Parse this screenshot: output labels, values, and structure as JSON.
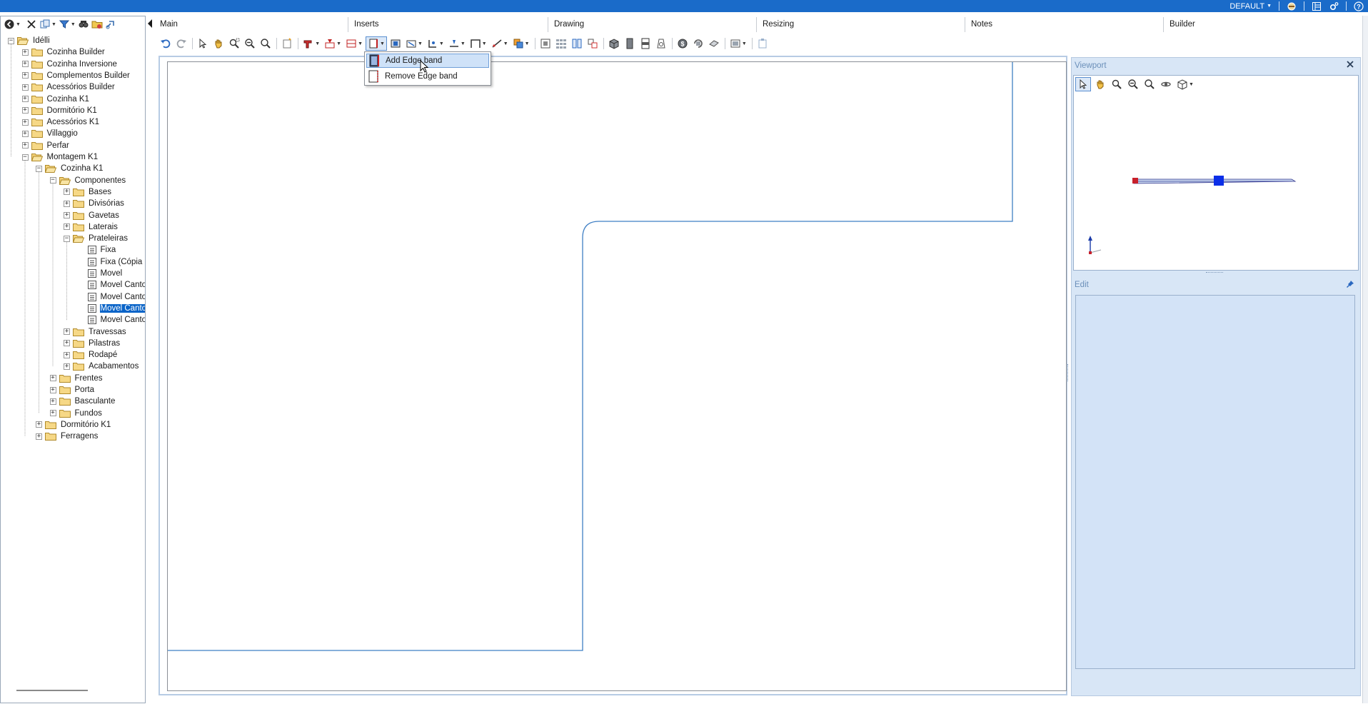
{
  "colors": {
    "title_bar": "#1a6bc9",
    "selection": "#0a64c8",
    "drawing_line": "#3f7fc4",
    "panel_bg": "#d8e6f6",
    "viewport_handle": "#0a2ee8",
    "viewport_marker": "#c8202a"
  },
  "topbar": {
    "profile": "DEFAULT",
    "icons": [
      "logo-icon",
      "layout-icon",
      "settings-icon",
      "help-icon"
    ]
  },
  "left_toolbar": {
    "icons": [
      "back-icon",
      "delete-icon",
      "copy-icon",
      "filter-icon",
      "search-icon",
      "folder-tools-icon",
      "link-icon"
    ]
  },
  "tree": {
    "items": [
      {
        "label": "Idélli",
        "level": 0,
        "type": "folder",
        "expanded": true
      },
      {
        "label": "Cozinha Builder",
        "level": 1,
        "type": "folder",
        "expanded": false
      },
      {
        "label": "Cozinha Inversione",
        "level": 1,
        "type": "folder",
        "expanded": false
      },
      {
        "label": "Complementos Builder",
        "level": 1,
        "type": "folder",
        "expanded": false
      },
      {
        "label": "Acessórios Builder",
        "level": 1,
        "type": "folder",
        "expanded": false
      },
      {
        "label": "Cozinha K1",
        "level": 1,
        "type": "folder",
        "expanded": false
      },
      {
        "label": "Dormitório K1",
        "level": 1,
        "type": "folder",
        "expanded": false
      },
      {
        "label": "Acessórios K1",
        "level": 1,
        "type": "folder",
        "expanded": false
      },
      {
        "label": "Villaggio",
        "level": 1,
        "type": "folder",
        "expanded": false
      },
      {
        "label": "Perfar",
        "level": 1,
        "type": "folder",
        "expanded": false
      },
      {
        "label": "Montagem K1",
        "level": 1,
        "type": "folder",
        "expanded": true
      },
      {
        "label": "Cozinha K1",
        "level": 2,
        "type": "folder",
        "expanded": true
      },
      {
        "label": "Componentes",
        "level": 3,
        "type": "folder",
        "expanded": true
      },
      {
        "label": "Bases",
        "level": 4,
        "type": "folder",
        "expanded": false
      },
      {
        "label": "Divisórias",
        "level": 4,
        "type": "folder",
        "expanded": false
      },
      {
        "label": "Gavetas",
        "level": 4,
        "type": "folder",
        "expanded": false
      },
      {
        "label": "Laterais",
        "level": 4,
        "type": "folder",
        "expanded": false
      },
      {
        "label": "Prateleiras",
        "level": 4,
        "type": "folder",
        "expanded": true
      },
      {
        "label": "Fixa",
        "level": 5,
        "type": "item"
      },
      {
        "label": "Fixa (Cópia",
        "level": 5,
        "type": "item"
      },
      {
        "label": "Movel",
        "level": 5,
        "type": "item"
      },
      {
        "label": "Movel Canto",
        "level": 5,
        "type": "item"
      },
      {
        "label": "Movel Canto",
        "level": 5,
        "type": "item"
      },
      {
        "label": "Movel Canto",
        "level": 5,
        "type": "item",
        "selected": true
      },
      {
        "label": "Movel Canto",
        "level": 5,
        "type": "item"
      },
      {
        "label": "Travessas",
        "level": 4,
        "type": "folder",
        "expanded": false
      },
      {
        "label": "Pilastras",
        "level": 4,
        "type": "folder",
        "expanded": false
      },
      {
        "label": "Rodapé",
        "level": 4,
        "type": "folder",
        "expanded": false
      },
      {
        "label": "Acabamentos",
        "level": 4,
        "type": "folder",
        "expanded": false
      },
      {
        "label": "Frentes",
        "level": 3,
        "type": "folder",
        "expanded": false
      },
      {
        "label": "Porta",
        "level": 3,
        "type": "folder",
        "expanded": false
      },
      {
        "label": "Basculante",
        "level": 3,
        "type": "folder",
        "expanded": false
      },
      {
        "label": "Fundos",
        "level": 3,
        "type": "folder",
        "expanded": false
      },
      {
        "label": "Dormitório K1",
        "level": 2,
        "type": "folder",
        "expanded": false
      },
      {
        "label": "Ferragens",
        "level": 2,
        "type": "folder",
        "expanded": false
      }
    ]
  },
  "sections": {
    "main": "Main",
    "inserts": "Inserts",
    "drawing": "Drawing",
    "resizing": "Resizing",
    "notes": "Notes",
    "builder": "Builder"
  },
  "toolbar": {
    "icons": [
      "undo-icon",
      "redo-icon",
      "select-icon",
      "pan-icon",
      "zoom-window-icon",
      "zoom-out-icon",
      "zoom-icon",
      "new-part-icon",
      "insert-hardware-icon",
      "insert-drill-icon",
      "insert-panel-icon",
      "edge-band-icon",
      "insert-groove-icon",
      "insert-cut-icon",
      "insert-line-icon",
      "insert-dimension-icon",
      "insert-rectangle-icon",
      "insert-path-icon",
      "insert-block-icon",
      "grid-icon",
      "grid-array-icon",
      "columns-icon",
      "mirror-icon",
      "box-icon",
      "panel-front-icon",
      "panel-side-icon",
      "material-icon",
      "money-icon",
      "rotate-icon",
      "texture-icon",
      "view-options-icon",
      "paste-icon"
    ]
  },
  "dropdown": {
    "items": [
      {
        "label": "Add Edge band",
        "icon": "add-edge-band-icon",
        "highlighted": true
      },
      {
        "label": "Remove Edge band",
        "icon": "remove-edge-band-icon",
        "highlighted": false
      }
    ]
  },
  "viewport": {
    "title": "Viewport",
    "tools": [
      "select-icon",
      "pan-icon",
      "zoom-window-icon",
      "zoom-out-icon",
      "zoom-icon",
      "orbit-icon",
      "view-cube-icon"
    ]
  },
  "edit": {
    "title": "Edit"
  }
}
